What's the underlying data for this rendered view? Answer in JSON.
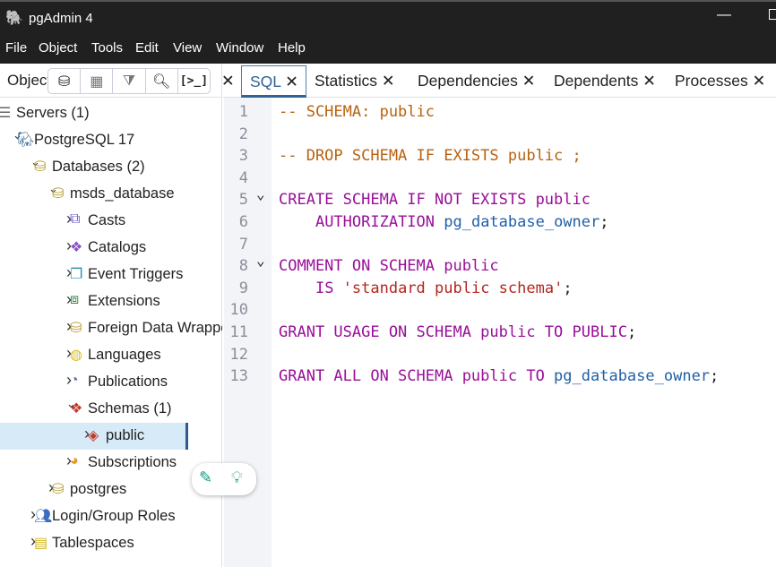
{
  "window": {
    "title": "pgAdmin 4"
  },
  "menu": [
    "File",
    "Object",
    "Tools",
    "Edit",
    "View",
    "Window",
    "Help"
  ],
  "left_panel": {
    "tab_label": "Object Explorer",
    "tools": [
      "query-tool-icon",
      "view-data-icon",
      "filtered-rows-icon",
      "search-objects-icon",
      "psql-tool-icon"
    ]
  },
  "tree": [
    {
      "label": "Servers (1)",
      "level": 0,
      "expanded": true,
      "icon": "servers-icon"
    },
    {
      "label": "PostgreSQL 17",
      "level": 1,
      "expanded": true,
      "icon": "postgres-elephant-icon"
    },
    {
      "label": "Databases (2)",
      "level": 2,
      "expanded": true,
      "icon": "database-icon"
    },
    {
      "label": "msds_database",
      "level": 3,
      "expanded": true,
      "icon": "database-icon"
    },
    {
      "label": "Casts",
      "level": 4,
      "expanded": false,
      "icon": "cast-icon"
    },
    {
      "label": "Catalogs",
      "level": 4,
      "expanded": false,
      "icon": "catalog-icon"
    },
    {
      "label": "Event Triggers",
      "level": 4,
      "expanded": false,
      "icon": "event-trigger-icon"
    },
    {
      "label": "Extensions",
      "level": 4,
      "expanded": false,
      "icon": "extension-icon"
    },
    {
      "label": "Foreign Data Wrappers",
      "level": 4,
      "expanded": false,
      "icon": "fdw-icon"
    },
    {
      "label": "Languages",
      "level": 4,
      "expanded": false,
      "icon": "language-icon"
    },
    {
      "label": "Publications",
      "level": 4,
      "expanded": false,
      "icon": "publication-icon"
    },
    {
      "label": "Schemas (1)",
      "level": 4,
      "expanded": true,
      "icon": "schema-icon"
    },
    {
      "label": "public",
      "level": 5,
      "expanded": false,
      "icon": "schema-public-icon",
      "selected": true
    },
    {
      "label": "Subscriptions",
      "level": 4,
      "expanded": false,
      "icon": "subscription-icon"
    },
    {
      "label": "postgres",
      "level": 3,
      "expanded": false,
      "icon": "database-icon"
    },
    {
      "label": "Login/Group Roles",
      "level": 2,
      "expanded": false,
      "icon": "roles-icon"
    },
    {
      "label": "Tablespaces",
      "level": 2,
      "expanded": false,
      "icon": "tablespace-icon"
    }
  ],
  "tabs": [
    {
      "label": "SQL",
      "active": true
    },
    {
      "label": "Statistics"
    },
    {
      "label": "Dependencies"
    },
    {
      "label": "Dependents"
    },
    {
      "label": "Processes"
    }
  ],
  "sql_lines": [
    {
      "n": "1",
      "parts": [
        [
          "cm",
          "-- SCHEMA: public"
        ]
      ]
    },
    {
      "n": "2",
      "parts": []
    },
    {
      "n": "3",
      "parts": [
        [
          "cm",
          "-- DROP SCHEMA IF EXISTS public ;"
        ]
      ]
    },
    {
      "n": "4",
      "parts": []
    },
    {
      "n": "5",
      "fold": true,
      "parts": [
        [
          "kw",
          "CREATE SCHEMA IF NOT EXISTS public"
        ]
      ]
    },
    {
      "n": "6",
      "parts": [
        [
          "pl",
          "    "
        ],
        [
          "kw",
          "AUTHORIZATION "
        ],
        [
          "nm",
          "pg_database_owner"
        ],
        [
          "pl",
          ";"
        ]
      ]
    },
    {
      "n": "7",
      "parts": []
    },
    {
      "n": "8",
      "fold": true,
      "parts": [
        [
          "kw",
          "COMMENT ON SCHEMA public"
        ]
      ]
    },
    {
      "n": "9",
      "parts": [
        [
          "pl",
          "    "
        ],
        [
          "kw",
          "IS "
        ],
        [
          "st",
          "'standard public schema'"
        ],
        [
          "pl",
          ";"
        ]
      ]
    },
    {
      "n": "10",
      "parts": []
    },
    {
      "n": "11",
      "parts": [
        [
          "kw",
          "GRANT USAGE ON SCHEMA public TO PUBLIC"
        ],
        [
          "pl",
          ";"
        ]
      ]
    },
    {
      "n": "12",
      "parts": []
    },
    {
      "n": "13",
      "parts": [
        [
          "kw",
          "GRANT ALL ON SCHEMA public TO "
        ],
        [
          "nm",
          "pg_database_owner"
        ],
        [
          "pl",
          ";"
        ]
      ]
    }
  ],
  "colors": {
    "comment": "#b8620f",
    "keyword": "#990f99",
    "identifier": "#1f5fa8",
    "string": "#b3261e",
    "accent": "#2f6396"
  }
}
